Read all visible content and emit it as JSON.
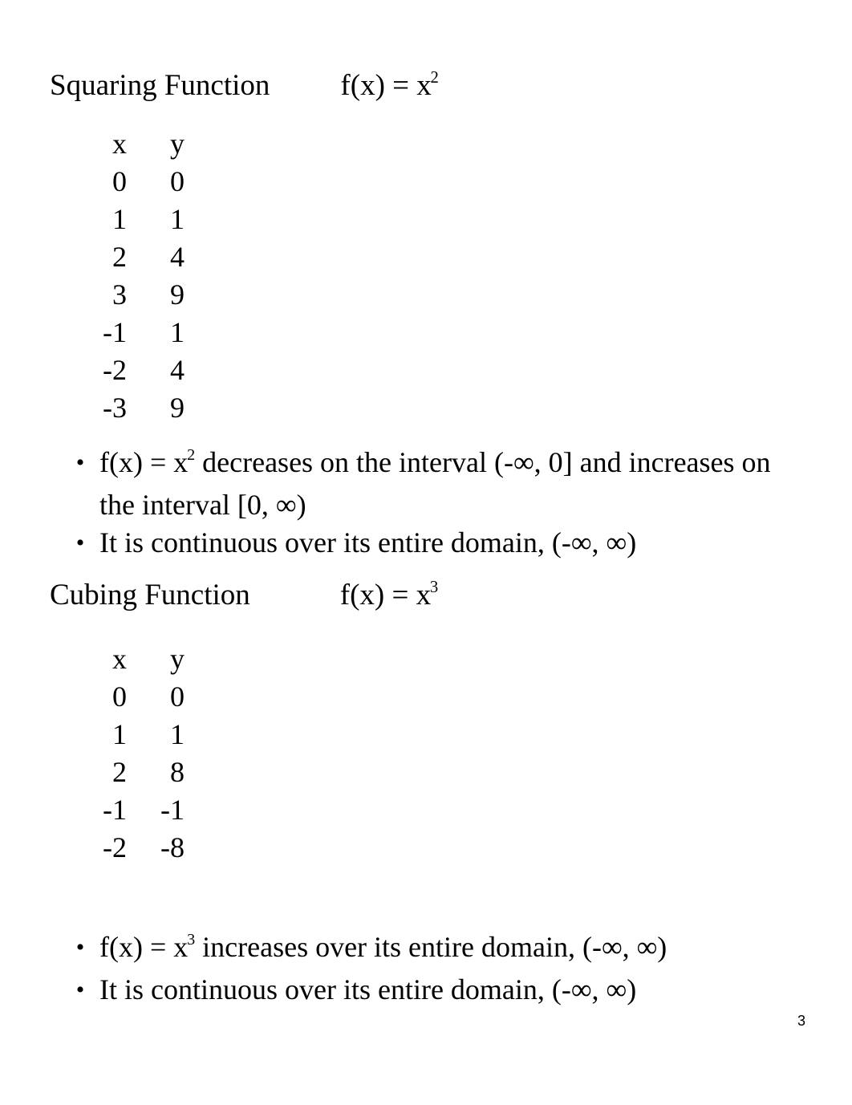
{
  "page": {
    "number": "3",
    "background": "#ffffff",
    "text_color": "#000000"
  },
  "sections": [
    {
      "id": "squaring",
      "name": "Squaring Function",
      "formula_lhs": "f(x) = x",
      "formula_exponent": "2",
      "table": {
        "headers": [
          "x",
          "y"
        ],
        "rows": [
          [
            "0",
            "0"
          ],
          [
            "1",
            "1"
          ],
          [
            "2",
            "4"
          ],
          [
            "3",
            "9"
          ],
          [
            "-1",
            "1"
          ],
          [
            "-2",
            "4"
          ],
          [
            "-3",
            "9"
          ]
        ]
      },
      "bullets": [
        {
          "pre": "f(x) = x",
          "exponent": "2",
          "post": " decreases on the interval (-∞, 0] and increases on the interval [0, ∞)"
        },
        {
          "pre": "",
          "exponent": "",
          "post": "It is continuous over its entire domain, (-∞, ∞)"
        }
      ]
    },
    {
      "id": "cubing",
      "name": "Cubing Function",
      "formula_lhs": "f(x) = x",
      "formula_exponent": "3",
      "table": {
        "headers": [
          "x",
          "y"
        ],
        "rows": [
          [
            "0",
            "0"
          ],
          [
            "1",
            "1"
          ],
          [
            "2",
            "8"
          ],
          [
            "-1",
            "-1"
          ],
          [
            "-2",
            "-8"
          ]
        ]
      },
      "bullets": [
        {
          "pre": "f(x) = x",
          "exponent": "3",
          "post": " increases over its entire domain, (-∞, ∞)"
        },
        {
          "pre": "",
          "exponent": "",
          "post": "It is continuous over its entire domain, (-∞, ∞)"
        }
      ]
    }
  ],
  "bullet_glyph": "•"
}
